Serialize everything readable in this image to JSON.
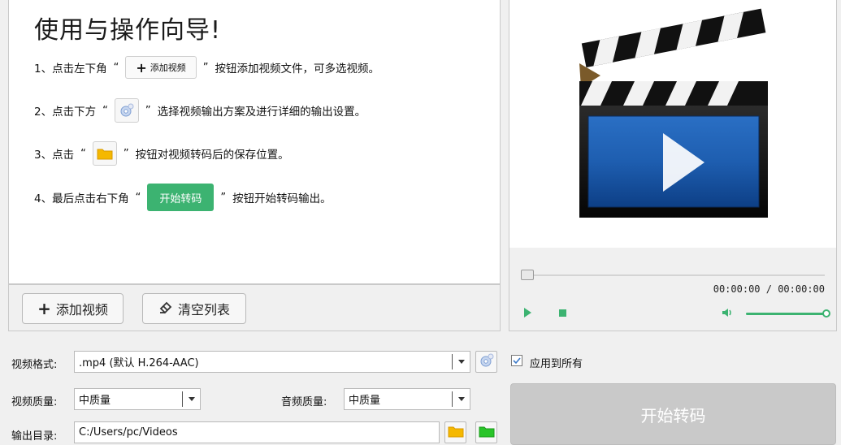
{
  "guide": {
    "title": "使用与操作向导!",
    "steps": [
      {
        "prefix": "1、点击左下角",
        "button": "添加视频",
        "suffix": "按钮添加视频文件，可多选视频。"
      },
      {
        "prefix": "2、点击下方",
        "suffix": "选择视频输出方案及进行详细的输出设置。"
      },
      {
        "prefix": "3、点击",
        "suffix": "按钮对视频转码后的保存位置。"
      },
      {
        "prefix": "4、最后点击右下角",
        "button": "开始转码",
        "suffix": "按钮开始转码输出。"
      }
    ],
    "quote_open": "“",
    "quote_close": "”"
  },
  "toolbar": {
    "add_video_label": "添加视频",
    "clear_list_label": "清空列表"
  },
  "player": {
    "time": "00:00:00 / 00:00:00",
    "seek_progress": 0,
    "volume": 1.0
  },
  "settings": {
    "format_label": "视频格式:",
    "format_value": ".mp4 (默认 H.264-AAC)",
    "apply_all_label": "应用到所有",
    "apply_all_checked": true,
    "video_quality_label": "视频质量:",
    "video_quality_value": "中质量",
    "audio_quality_label": "音频质量:",
    "audio_quality_value": "中质量",
    "output_dir_label": "输出目录:",
    "output_dir_value": "C:/Users/pc/Videos",
    "start_label": "开始转码"
  },
  "colors": {
    "accent_green": "#3cb371",
    "folder_yellow": "#f5b800",
    "folder_green": "#28c428",
    "disabled_button": "#c9c9c9"
  },
  "icons": {
    "settings": "gear-film-icon",
    "folder_browse": "folder-icon",
    "folder_open": "folder-open-icon",
    "clapper": "clapperboard-icon",
    "volume": "speaker-icon"
  }
}
